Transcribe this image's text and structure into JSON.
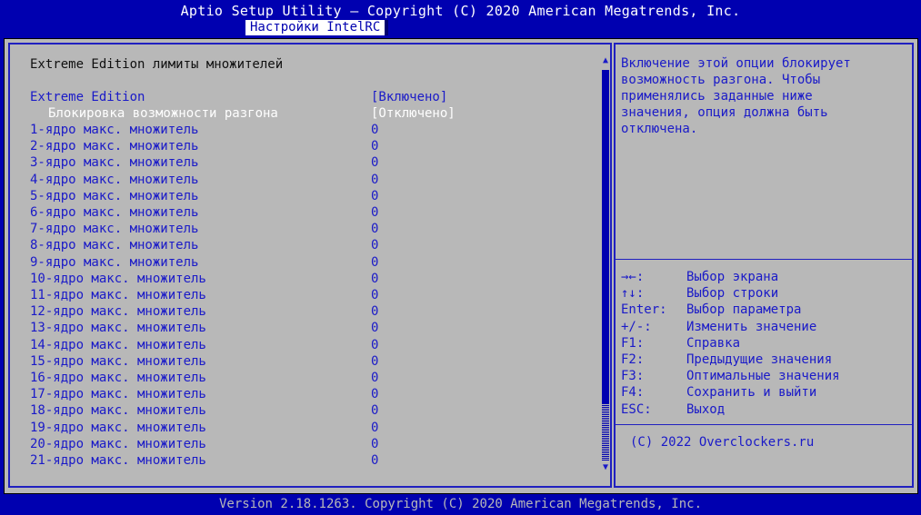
{
  "header": {
    "title": "Aptio Setup Utility – Copyright (C) 2020 American Megatrends, Inc.",
    "active_tab": "Настройки IntelRC"
  },
  "main": {
    "heading": "Extreme Edition лимиты множителей",
    "extreme_edition": {
      "label": "Extreme Edition",
      "value": "[Включено]"
    },
    "overclock_lock": {
      "label": "Блокировка возможности разгона",
      "value": "[Отключено]"
    },
    "cores": [
      {
        "label": "1-ядро макс. множитель",
        "value": "0"
      },
      {
        "label": "2-ядро макс. множитель",
        "value": "0"
      },
      {
        "label": "3-ядро макс. множитель",
        "value": "0"
      },
      {
        "label": "4-ядро макс. множитель",
        "value": "0"
      },
      {
        "label": "5-ядро макс. множитель",
        "value": "0"
      },
      {
        "label": "6-ядро макс. множитель",
        "value": "0"
      },
      {
        "label": "7-ядро макс. множитель",
        "value": "0"
      },
      {
        "label": "8-ядро макс. множитель",
        "value": "0"
      },
      {
        "label": "9-ядро макс. множитель",
        "value": "0"
      },
      {
        "label": "10-ядро макс. множитель",
        "value": "0"
      },
      {
        "label": "11-ядро макс. множитель",
        "value": "0"
      },
      {
        "label": "12-ядро макс. множитель",
        "value": "0"
      },
      {
        "label": "13-ядро макс. множитель",
        "value": "0"
      },
      {
        "label": "14-ядро макс. множитель",
        "value": "0"
      },
      {
        "label": "15-ядро макс. множитель",
        "value": "0"
      },
      {
        "label": "16-ядро макс. множитель",
        "value": "0"
      },
      {
        "label": "17-ядро макс. множитель",
        "value": "0"
      },
      {
        "label": "18-ядро макс. множитель",
        "value": "0"
      },
      {
        "label": "19-ядро макс. множитель",
        "value": "0"
      },
      {
        "label": "20-ядро макс. множитель",
        "value": "0"
      },
      {
        "label": "21-ядро макс. множитель",
        "value": "0"
      }
    ]
  },
  "scrollbar": {
    "up_icon": "▲",
    "down_icon": "▼"
  },
  "help": {
    "text": "Включение этой опции блокирует\nвозможность разгона. Чтобы\nприменялись заданные ниже\nзначения, опция должна быть\nотключена.",
    "keys": [
      {
        "key": "→←:",
        "desc": "Выбор экрана"
      },
      {
        "key": "↑↓:",
        "desc": "Выбор строки"
      },
      {
        "key": "Enter:",
        "desc": "Выбор параметра"
      },
      {
        "key": "+/-:",
        "desc": "Изменить значение"
      },
      {
        "key": "F1:",
        "desc": "Справка"
      },
      {
        "key": "F2:",
        "desc": "Предыдущие значения"
      },
      {
        "key": "F3:",
        "desc": "Оптимальные значения"
      },
      {
        "key": "F4:",
        "desc": "Сохранить и выйти"
      },
      {
        "key": "ESC:",
        "desc": "Выход"
      }
    ],
    "copyright": "(C) 2022 Overclockers.ru"
  },
  "footer": {
    "version": "Version 2.18.1263. Copyright (C) 2020 American Megatrends, Inc."
  },
  "colors": {
    "bios_blue": "#0000b0",
    "panel_gray": "#b8b8b8",
    "item_blue": "#1a1ac8",
    "selected_white": "#ffffff"
  }
}
